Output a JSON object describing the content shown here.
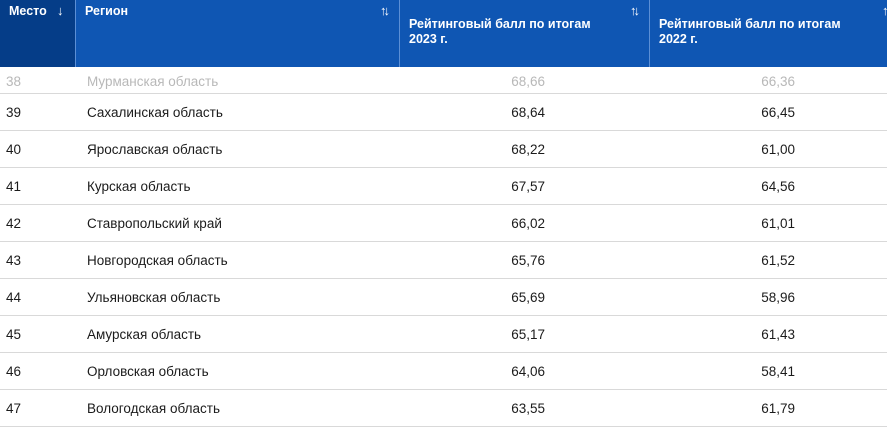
{
  "header": {
    "col_place": "Место",
    "col_region": "Регион",
    "col_2023_line1": "Рейтинговый балл по итогам",
    "col_2023_line2": "2023 г.",
    "col_2022_line1": "Рейтинговый балл по итогам",
    "col_2022_line2": "2022 г.",
    "sort_active_icon": "↓",
    "sort_inactive_icon": "↑↓"
  },
  "rows": [
    {
      "rank": "38",
      "region": "Мурманская область",
      "score_2023": "68,66",
      "score_2022": "66,36"
    },
    {
      "rank": "39",
      "region": "Сахалинская область",
      "score_2023": "68,64",
      "score_2022": "66,45"
    },
    {
      "rank": "40",
      "region": "Ярославская область",
      "score_2023": "68,22",
      "score_2022": "61,00"
    },
    {
      "rank": "41",
      "region": "Курская область",
      "score_2023": "67,57",
      "score_2022": "64,56"
    },
    {
      "rank": "42",
      "region": "Ставропольский край",
      "score_2023": "66,02",
      "score_2022": "61,01"
    },
    {
      "rank": "43",
      "region": "Новгородская область",
      "score_2023": "65,76",
      "score_2022": "61,52"
    },
    {
      "rank": "44",
      "region": "Ульяновская область",
      "score_2023": "65,69",
      "score_2022": "58,96"
    },
    {
      "rank": "45",
      "region": "Амурская область",
      "score_2023": "65,17",
      "score_2022": "61,43"
    },
    {
      "rank": "46",
      "region": "Орловская область",
      "score_2023": "64,06",
      "score_2022": "58,41"
    },
    {
      "rank": "47",
      "region": "Вологодская область",
      "score_2023": "63,55",
      "score_2022": "61,79"
    }
  ],
  "colors": {
    "header_bg": "#0f56b3",
    "header_active_bg": "#053d88",
    "row_border": "#d9d9d9",
    "text": "#1b1b1b"
  }
}
